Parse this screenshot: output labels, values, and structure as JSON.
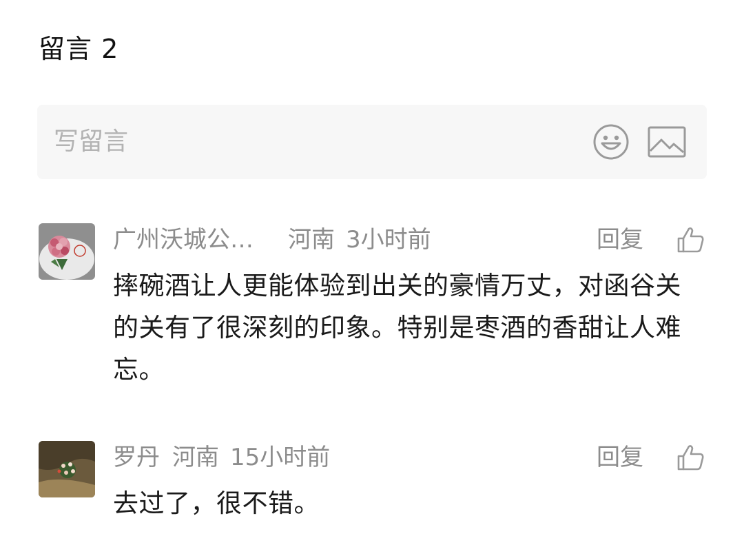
{
  "section": {
    "title": "留言 2"
  },
  "compose": {
    "placeholder": "写留言",
    "emoji_icon": "smiley-icon",
    "image_icon": "image-icon"
  },
  "comments": [
    {
      "author": "广州沃城公…",
      "location": "河南",
      "time": "3小时前",
      "reply_label": "回复",
      "like_icon": "thumbs-up-icon",
      "text": "摔碗酒让人更能体验到出关的豪情万丈，对函谷关的关有了很深刻的印象。特别是枣酒的香甜让人难忘。"
    },
    {
      "author": "罗丹",
      "location": "河南",
      "time": "15小时前",
      "reply_label": "回复",
      "like_icon": "thumbs-up-icon",
      "text": "去过了，很不错。"
    }
  ],
  "colors": {
    "meta_text": "#8c8c8c",
    "body_text": "#1a1a1a",
    "input_bg": "#f7f7f7",
    "placeholder": "#b3b3b3"
  }
}
